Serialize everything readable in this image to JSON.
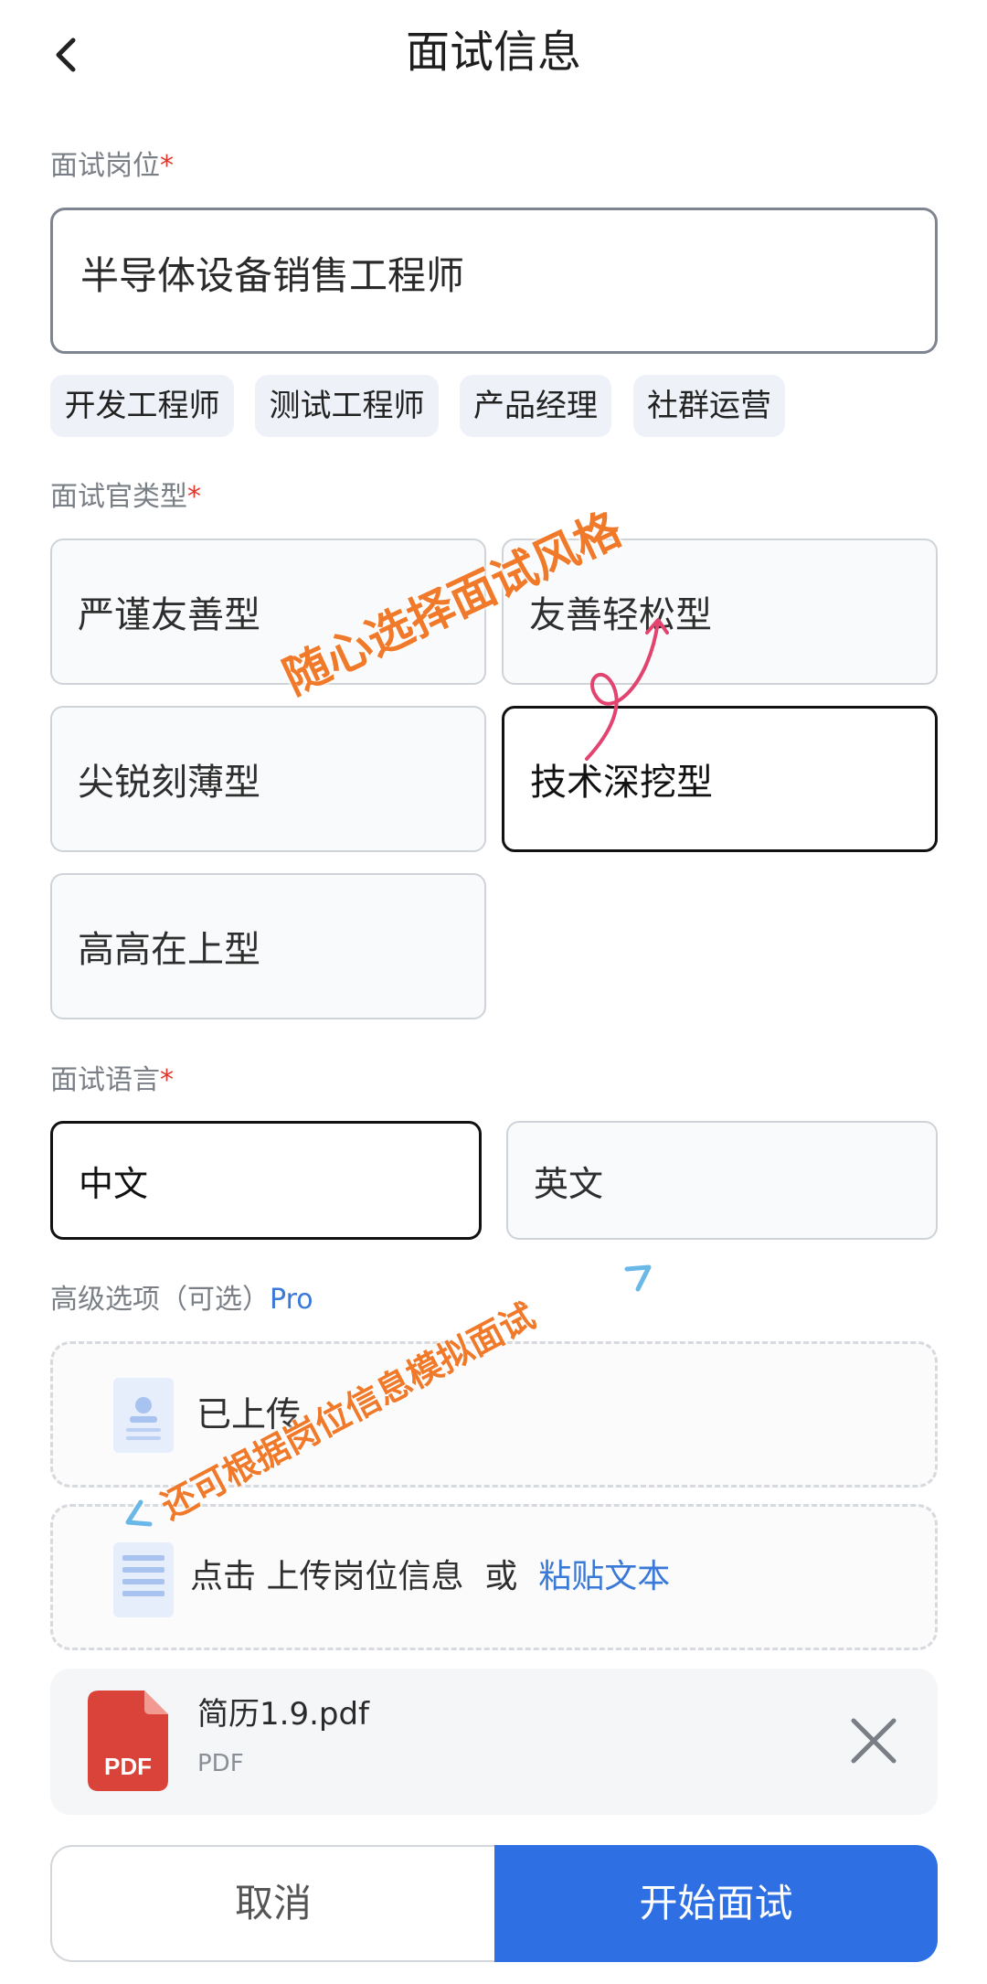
{
  "header": {
    "title": "面试信息"
  },
  "position": {
    "label": "面试岗位",
    "required_mark": "*",
    "value": "半导体设备销售工程师",
    "chips": [
      "开发工程师",
      "测试工程师",
      "产品经理",
      "社群运营"
    ]
  },
  "interviewer": {
    "label": "面试官类型",
    "required_mark": "*",
    "options": [
      "严谨友善型",
      "友善轻松型",
      "尖锐刻薄型",
      "技术深挖型",
      "高高在上型"
    ],
    "selected": "技术深挖型"
  },
  "language": {
    "label": "面试语言",
    "required_mark": "*",
    "options": [
      "中文",
      "英文"
    ],
    "selected": "中文"
  },
  "advanced": {
    "label": "高级选项（可选）",
    "pro": "Pro",
    "resume_uploaded": "已上传",
    "job_prefix": "点击",
    "job_upload": "上传岗位信息",
    "job_or": "或",
    "job_paste": "粘贴文本"
  },
  "file": {
    "name": "简历1.9.pdf",
    "type": "PDF",
    "badge": "PDF"
  },
  "actions": {
    "cancel": "取消",
    "start": "开始面试"
  },
  "annotations": {
    "style_note": "随心选择面试风格",
    "job_note": "还可根据岗位信息模拟面试"
  },
  "colors": {
    "accent": "#2f6fe4",
    "link": "#3a79d8",
    "required": "#e0362b",
    "annotation": "#f0792a",
    "pdf": "#d9433a"
  }
}
